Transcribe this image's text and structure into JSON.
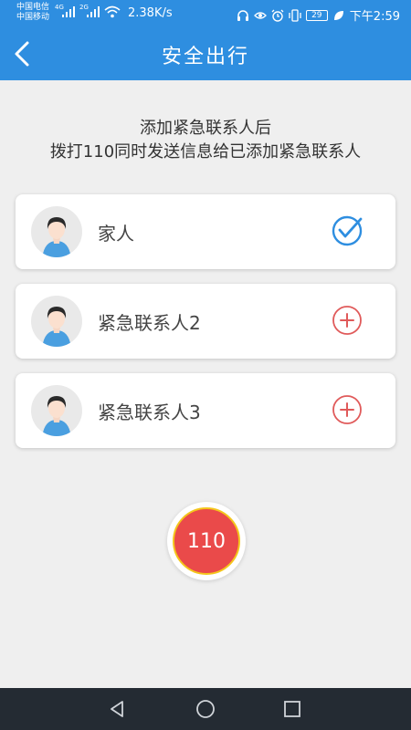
{
  "status_bar": {
    "carrier1": "中国电信",
    "carrier2": "中国移动",
    "net1": "4G",
    "net2": "2G",
    "speed": "2.38K/s",
    "battery": "29",
    "time": "下午2:59"
  },
  "header": {
    "title": "安全出行"
  },
  "intro": {
    "line1": "添加紧急联系人后",
    "line2": "拨打110同时发送信息给已添加紧急联系人"
  },
  "contacts": [
    {
      "name": "家人",
      "state": "added",
      "icon": "check-circle-icon"
    },
    {
      "name": "紧急联系人2",
      "state": "empty",
      "icon": "plus-circle-icon"
    },
    {
      "name": "紧急联系人3",
      "state": "empty",
      "icon": "plus-circle-icon"
    }
  ],
  "sos": {
    "label": "110"
  },
  "colors": {
    "header": "#2e8ee0",
    "check": "#2e8ee0",
    "plus": "#e05a5a",
    "sos_fill": "#ea4a4a",
    "sos_ring": "#f4c61c"
  }
}
